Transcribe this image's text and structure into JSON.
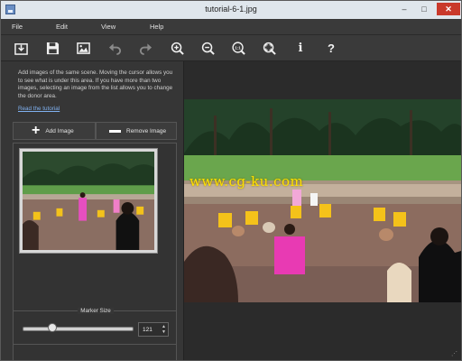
{
  "window": {
    "title": "tutorial-6-1.jpg"
  },
  "title_controls": {
    "minimize": "–",
    "maximize": "□",
    "close": "✕"
  },
  "menu": [
    "File",
    "Edit",
    "View",
    "Help"
  ],
  "toolbar": {
    "buttons": [
      "save-to-disk",
      "save",
      "open-image",
      "undo",
      "redo",
      "zoom-in",
      "zoom-out",
      "zoom-actual",
      "zoom-fit",
      "info",
      "help"
    ],
    "zoom_actual_label": "1:1",
    "info_label": "i",
    "help_label": "?"
  },
  "panel": {
    "description": "Add images of the same scene. Moving the cursor allows you to see what is under this area. If you have more than two images, selecting an image from the list allows you to change the donor area.",
    "tutorial_link": "Read the tutorial",
    "add_image": "Add Image",
    "remove_image": "Remove Image",
    "marker_size_label": "Marker Size",
    "marker_size_value": "121",
    "marker_slider_fraction": 0.25
  },
  "canvas": {
    "watermark": "www.cg-ku.com"
  },
  "colors": {
    "accent_link": "#7fb0ef",
    "close_button": "#c9392b",
    "watermark": "#ffe100"
  }
}
